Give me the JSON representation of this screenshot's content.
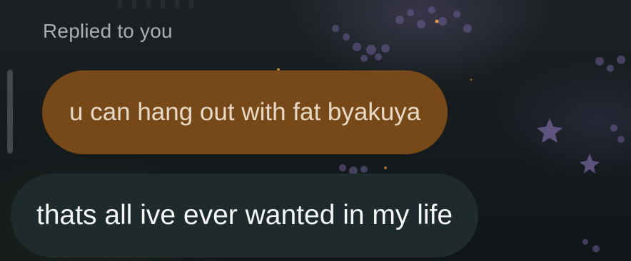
{
  "reply": {
    "label": "Replied to you",
    "quoted_message": "u can hang out with fat byakuya",
    "quoted_bubble_color": "#774818"
  },
  "message": {
    "text": "thats all ive ever wanted in my life",
    "bubble_color": "#1f2a2c"
  },
  "background": {
    "theme": "dark night garden with purple flowers and fireflies"
  }
}
